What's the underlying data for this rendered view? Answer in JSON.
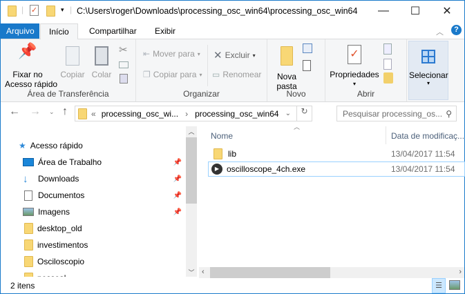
{
  "window": {
    "title": "C:\\Users\\roger\\Downloads\\processing_osc_win64\\processing_osc_win64"
  },
  "tabs": [
    {
      "label": "Arquivo"
    },
    {
      "label": "Início"
    },
    {
      "label": "Compartilhar"
    },
    {
      "label": "Exibir"
    }
  ],
  "ribbon": {
    "clipboard": {
      "label": "Área de Transferência",
      "pin": "Fixar no\nAcesso rápido",
      "copy": "Copiar",
      "paste": "Colar"
    },
    "organize": {
      "label": "Organizar",
      "move": "Mover para",
      "copy_to": "Copiar para",
      "delete": "Excluir",
      "rename": "Renomear"
    },
    "new": {
      "label": "Novo",
      "new_folder": "Nova\npasta"
    },
    "open": {
      "label": "Abrir",
      "properties": "Propriedades"
    },
    "select": {
      "label": "Selecionar"
    }
  },
  "address": {
    "crumbs": [
      "processing_osc_wi...",
      "processing_osc_win64"
    ],
    "search_placeholder": "Pesquisar processing_os..."
  },
  "sidebar": {
    "quick_access": "Acesso rápido",
    "items": [
      {
        "label": "Área de Trabalho",
        "icon": "desktop-icon",
        "pinned": true
      },
      {
        "label": "Downloads",
        "icon": "download-icon",
        "pinned": true
      },
      {
        "label": "Documentos",
        "icon": "document-icon",
        "pinned": true
      },
      {
        "label": "Imagens",
        "icon": "pictures-icon",
        "pinned": true
      },
      {
        "label": "desktop_old",
        "icon": "folder-icon",
        "pinned": false
      },
      {
        "label": "investimentos",
        "icon": "folder-icon",
        "pinned": false
      },
      {
        "label": "Osciloscopio",
        "icon": "folder-icon",
        "pinned": false
      },
      {
        "label": "pessoal",
        "icon": "folder-icon",
        "pinned": false
      }
    ]
  },
  "files": {
    "columns": [
      "Nome",
      "Data de modificaç..."
    ],
    "rows": [
      {
        "name": "lib",
        "date": "13/04/2017 11:54",
        "icon": "folder-icon"
      },
      {
        "name": "oscilloscope_4ch.exe",
        "date": "13/04/2017 11:54",
        "icon": "exe-icon"
      }
    ]
  },
  "status": {
    "count": "2 itens"
  },
  "colors": {
    "accent": "#1979ca",
    "selection": "#cce8ff"
  }
}
